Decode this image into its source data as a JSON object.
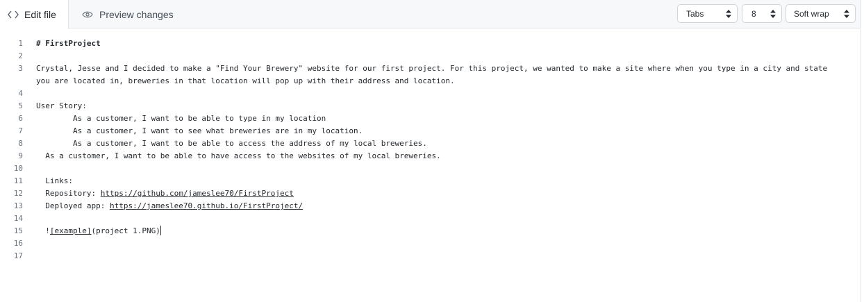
{
  "tabs": {
    "edit_label": "Edit file",
    "preview_label": "Preview changes"
  },
  "toolbar": {
    "indent_mode": "Tabs",
    "indent_size": "8",
    "wrap_mode": "Soft wrap"
  },
  "editor": {
    "lines": [
      {
        "num": "1",
        "text": "# FirstProject"
      },
      {
        "num": "2",
        "text": ""
      },
      {
        "num": "3",
        "text": "Crystal, Jesse and I decided to make a \"Find Your Brewery\" website for our first project. For this project, we wanted to make a site where when you type in a city and state you are located in, breweries in that location will pop up with their address and location."
      },
      {
        "num": "4",
        "text": ""
      },
      {
        "num": "5",
        "text": "User Story:"
      },
      {
        "num": "6",
        "text": "        As a customer, I want to be able to type in my location"
      },
      {
        "num": "7",
        "text": "        As a customer, I want to see what breweries are in my location."
      },
      {
        "num": "8",
        "text": "        As a customer, I want to be able to access the address of my local breweries."
      },
      {
        "num": "9",
        "text": "  As a customer, I want to be able to have access to the websites of my local breweries."
      },
      {
        "num": "10",
        "text": ""
      },
      {
        "num": "11",
        "text": "  Links:"
      },
      {
        "num": "12",
        "prefix": "  Repository: ",
        "link": "https://github.com/jameslee70/FirstProject"
      },
      {
        "num": "13",
        "prefix": "  Deployed app: ",
        "link": "https://jameslee70.github.io/FirstProject/"
      },
      {
        "num": "14",
        "text": ""
      },
      {
        "num": "15",
        "prefix": "  !",
        "link": "[example]",
        "suffix": "(project 1.PNG)"
      },
      {
        "num": "16",
        "text": ""
      },
      {
        "num": "17",
        "text": ""
      }
    ]
  }
}
